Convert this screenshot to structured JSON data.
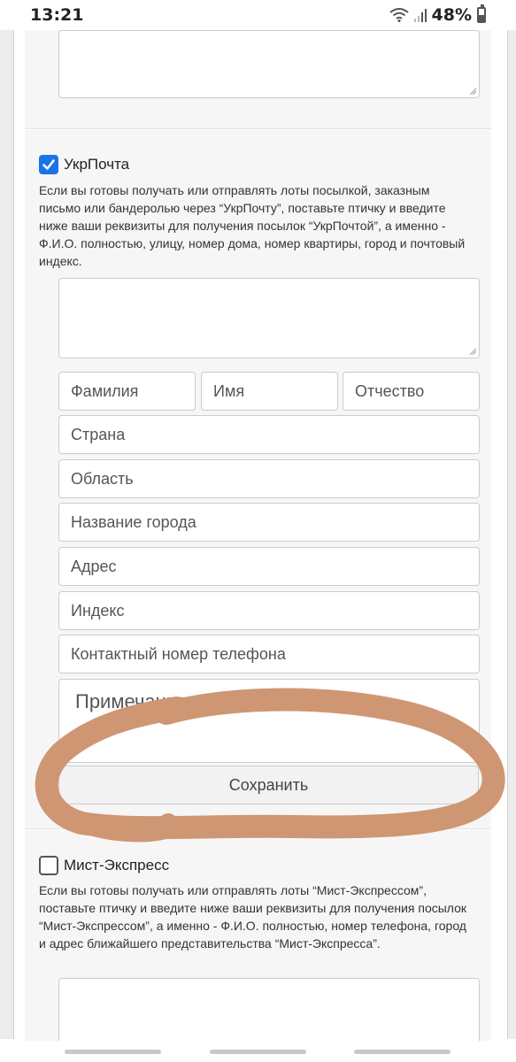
{
  "status_bar": {
    "time": "13:21",
    "battery_percent": "48%",
    "battery_level": 0.48
  },
  "ukrposhta": {
    "checked": true,
    "label": "УкрПочта",
    "description": "Если вы готовы получать или отправлять лоты посылкой, заказным письмо или бандеролью через “УкрПочту”, поставьте птичку и введите ниже ваши реквизиты для получения посылок “УкрПочтой”, а именно - Ф.И.О. полностью, улицу, номер дома, номер квартиры, город и почтовый индекс.",
    "fields": {
      "last_name": "Фамилия",
      "first_name": "Имя",
      "patronymic": "Отчество",
      "country": "Страна",
      "region": "Область",
      "city": "Название города",
      "address": "Адрес",
      "postal_code": "Индекс",
      "phone": "Контактный номер телефона",
      "notes": "Примечания"
    },
    "save_label": "Сохранить"
  },
  "mist_express": {
    "checked": false,
    "label": "Мист-Экспресс",
    "description": "Если вы готовы получать или отправлять лоты “Мист-Экспрессом”, поставьте птичку и введите ниже ваши реквизиты для получения посылок “Мист-Экспрессом”, а именно - Ф.И.О. полностью, номер телефона, город и адрес ближайшего представительства “Мист-Экспресса”."
  },
  "colors": {
    "checkbox_accent": "#1a73e8",
    "scribble": "#cf9673",
    "panel_bg": "#f6f6f6"
  }
}
